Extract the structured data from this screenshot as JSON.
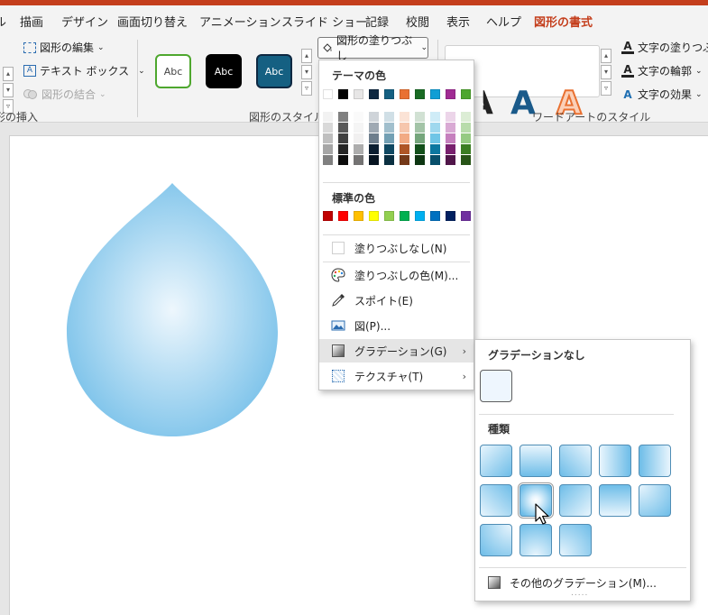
{
  "tabs": [
    {
      "label": "ル"
    },
    {
      "label": "描画"
    },
    {
      "label": "デザイン"
    },
    {
      "label": "画面切り替え"
    },
    {
      "label": "アニメーション"
    },
    {
      "label": "スライド ショー"
    },
    {
      "label": "記録"
    },
    {
      "label": "校閲"
    },
    {
      "label": "表示"
    },
    {
      "label": "ヘルプ"
    },
    {
      "label": "図形の書式"
    }
  ],
  "ribbon": {
    "insert": {
      "edit_shape": "図形の編集",
      "text_box": "テキスト ボックス",
      "merge_shapes": "図形の結合",
      "group_label": "形の挿入"
    },
    "styles": {
      "sample": "Abc",
      "group_label": "図形のスタイル",
      "fill_button": "図形の塗りつぶし"
    },
    "wordart": {
      "text_fill": "文字の塗りつぶし",
      "text_outline": "文字の輪郭",
      "text_effects": "文字の効果",
      "group_label": "ワードアートのスタイル",
      "letter": "A"
    }
  },
  "fill_menu": {
    "theme_colors_title": "テーマの色",
    "theme_colors": [
      "#ffffff",
      "#000000",
      "#e7e6e6",
      "#0e2841",
      "#156082",
      "#e97132",
      "#196b24",
      "#0f9ed5",
      "#a02b93",
      "#4ea72e"
    ],
    "standard_colors_title": "標準の色",
    "standard_colors": [
      "#c00000",
      "#ff0000",
      "#ffc000",
      "#ffff00",
      "#92d050",
      "#00b050",
      "#00b0f0",
      "#0070c0",
      "#002060",
      "#7030a0"
    ],
    "items": {
      "no_fill": "塗りつぶしなし(N)",
      "more_colors": "塗りつぶしの色(M)...",
      "eyedropper": "スポイト(E)",
      "picture": "図(P)...",
      "gradient": "グラデーション(G)",
      "texture": "テクスチャ(T)"
    }
  },
  "gradient_menu": {
    "no_gradient_title": "グラデーションなし",
    "types_title": "種類",
    "more_gradients": "その他のグラデーション(M)...",
    "footer_dots": "....."
  },
  "colors": {
    "accent": "#c43e1c",
    "drop_light": "#eef7fd",
    "drop_dark": "#7dc3ea"
  }
}
